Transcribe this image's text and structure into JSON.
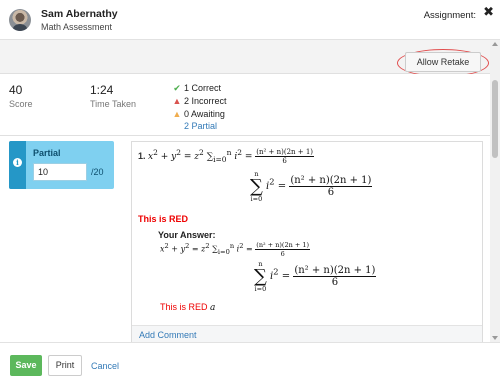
{
  "header": {
    "student_name": "Sam Abernathy",
    "assessment_name": "Math Assessment",
    "assignment_label": "Assignment:",
    "close_icon": "close-icon",
    "close_glyph": "✖"
  },
  "toolbar": {
    "allow_retake_label": "Allow Retake",
    "highlight_color": "#e14d4d"
  },
  "stats": {
    "score_value": "40",
    "score_label": "Score",
    "time_value": "1:24",
    "time_label": "Time Taken",
    "summary": {
      "correct": "1 Correct",
      "incorrect": "2 Incorrect",
      "awaiting": "0 Awaiting",
      "partial": "2 Partial"
    },
    "icons": {
      "correct": "check-icon",
      "incorrect": "warning-icon",
      "awaiting": "warning-icon"
    },
    "colors": {
      "correct": "#4cae4c",
      "incorrect": "#d9534f",
      "awaiting": "#f0ad4e"
    }
  },
  "grading": {
    "title": "Partial",
    "score_input_value": "10",
    "max_label": "/20",
    "card_color": "#7fd0f0",
    "icon": "info-icon"
  },
  "question": {
    "number": "1.",
    "red_text": "This is RED",
    "your_answer_label": "Your Answer:",
    "answer_red_text": "This is RED",
    "answer_trailing_var": "a",
    "add_comment_label": "Add Comment",
    "math": {
      "x2": "x",
      "plus": " + ",
      "y2": "y",
      "eq": " = ",
      "z2": "z",
      "exp2": "2",
      "sum_upper": "n",
      "sum_lower": "i=0",
      "i_var": "i",
      "frac_num": "(n² + n)(2n + 1)",
      "frac_den": "6"
    }
  },
  "footer": {
    "save_label": "Save",
    "print_label": "Print",
    "cancel_label": "Cancel"
  }
}
